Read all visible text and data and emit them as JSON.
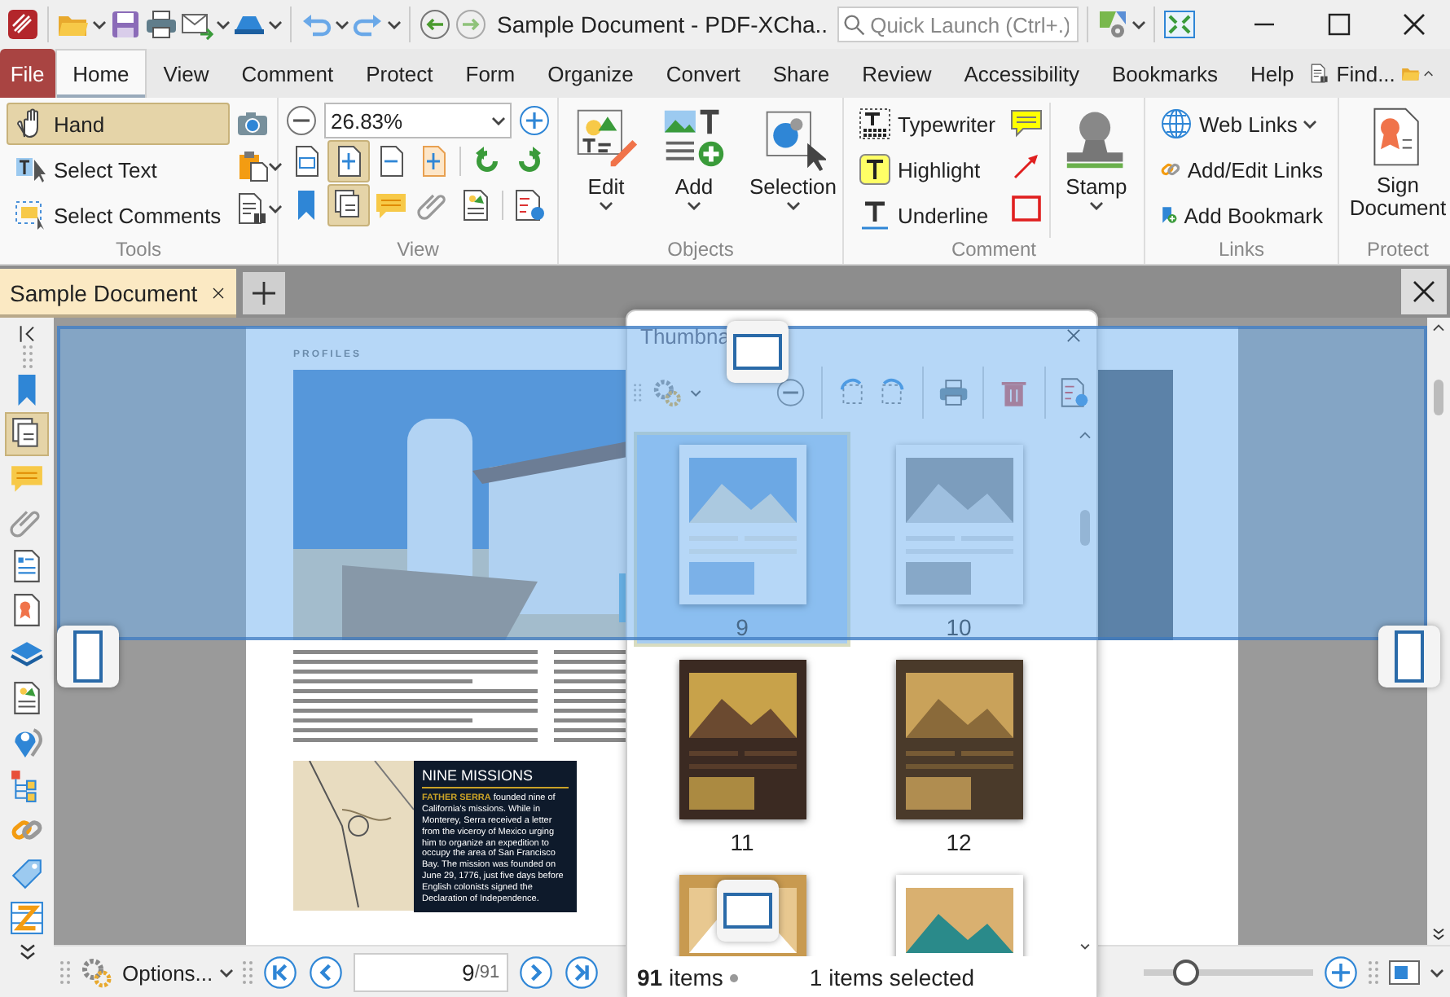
{
  "window": {
    "title": "Sample Document - PDF-XCha..",
    "quick_launch": {
      "placeholder": "Quick Launch (Ctrl+.)"
    }
  },
  "menu_tabs": [
    {
      "label": "File",
      "kind": "file",
      "selected": false
    },
    {
      "label": "Home",
      "kind": "tab",
      "selected": true
    },
    {
      "label": "View",
      "kind": "tab",
      "selected": false
    },
    {
      "label": "Comment",
      "kind": "tab",
      "selected": false
    },
    {
      "label": "Protect",
      "kind": "tab",
      "selected": false
    },
    {
      "label": "Form",
      "kind": "tab",
      "selected": false
    },
    {
      "label": "Organize",
      "kind": "tab",
      "selected": false
    },
    {
      "label": "Convert",
      "kind": "tab",
      "selected": false
    },
    {
      "label": "Share",
      "kind": "tab",
      "selected": false
    },
    {
      "label": "Review",
      "kind": "tab",
      "selected": false
    },
    {
      "label": "Accessibility",
      "kind": "tab",
      "selected": false
    },
    {
      "label": "Bookmarks",
      "kind": "tab",
      "selected": false
    },
    {
      "label": "Help",
      "kind": "tab",
      "selected": false
    }
  ],
  "find_button": "Find...",
  "ribbon": {
    "tools": {
      "label": "Tools",
      "items": [
        {
          "label": "Hand",
          "selected": true
        },
        {
          "label": "Select Text",
          "selected": false
        },
        {
          "label": "Select Comments",
          "selected": false
        }
      ]
    },
    "view": {
      "label": "View",
      "zoom": "26.83%",
      "buttons": [
        {
          "selected": false
        },
        {
          "selected": true
        },
        {
          "selected": false
        },
        {
          "selected": false
        },
        {
          "selected": false
        },
        {
          "selected": false
        },
        {
          "selected": false
        },
        {
          "selected": true
        },
        {
          "selected": false
        },
        {
          "selected": false
        },
        {
          "selected": false
        },
        {
          "selected": false
        }
      ]
    },
    "objects": {
      "label": "Objects",
      "buttons": [
        "Edit",
        "Add",
        "Selection"
      ]
    },
    "comment": {
      "label": "Comment",
      "tools": [
        "Typewriter",
        "Highlight",
        "Underline"
      ],
      "stamp": "Stamp"
    },
    "links": {
      "label": "Links",
      "items": [
        "Web Links",
        "Add/Edit Links",
        "Add Bookmark"
      ]
    },
    "protect": {
      "label": "Protect",
      "button": "Sign Document"
    }
  },
  "document_tabs": [
    {
      "label": "Sample Document",
      "selected": true
    }
  ],
  "sidebar": {
    "items": [
      {
        "selected": false
      },
      {
        "selected": true
      },
      {
        "selected": false
      },
      {
        "selected": false
      },
      {
        "selected": false
      },
      {
        "selected": false
      },
      {
        "selected": false
      },
      {
        "selected": false
      },
      {
        "selected": false
      },
      {
        "selected": false
      },
      {
        "selected": false
      },
      {
        "selected": false
      },
      {
        "selected": false
      }
    ]
  },
  "document": {
    "section": "PROFILES",
    "box": {
      "heading": "NINE MISSIONS",
      "text": "**FATHER SERRA** founded nine of California's missions. While in Monterey, Serra received a letter from the viceroy of Mexico urging him to organize an expedition to occupy the area of San Francisco Bay. The mission was founded on June 29, 1776, just five days before English colonists signed the Declaration of Independence."
    }
  },
  "thumbnails": {
    "title": "Thumbna",
    "pages": [
      {
        "label": "9",
        "selected": true
      },
      {
        "label": "10",
        "selected": false
      },
      {
        "label": "11",
        "selected": false
      },
      {
        "label": "12",
        "selected": false
      },
      {
        "selected": false
      },
      {
        "selected": false
      }
    ],
    "status": {
      "count": "**91** items",
      "selection": "1 items selected"
    }
  },
  "navigation": {
    "options": "Options...",
    "page": "9",
    "page_count": "/91",
    "zoom": {
      "level": 0.2
    }
  }
}
